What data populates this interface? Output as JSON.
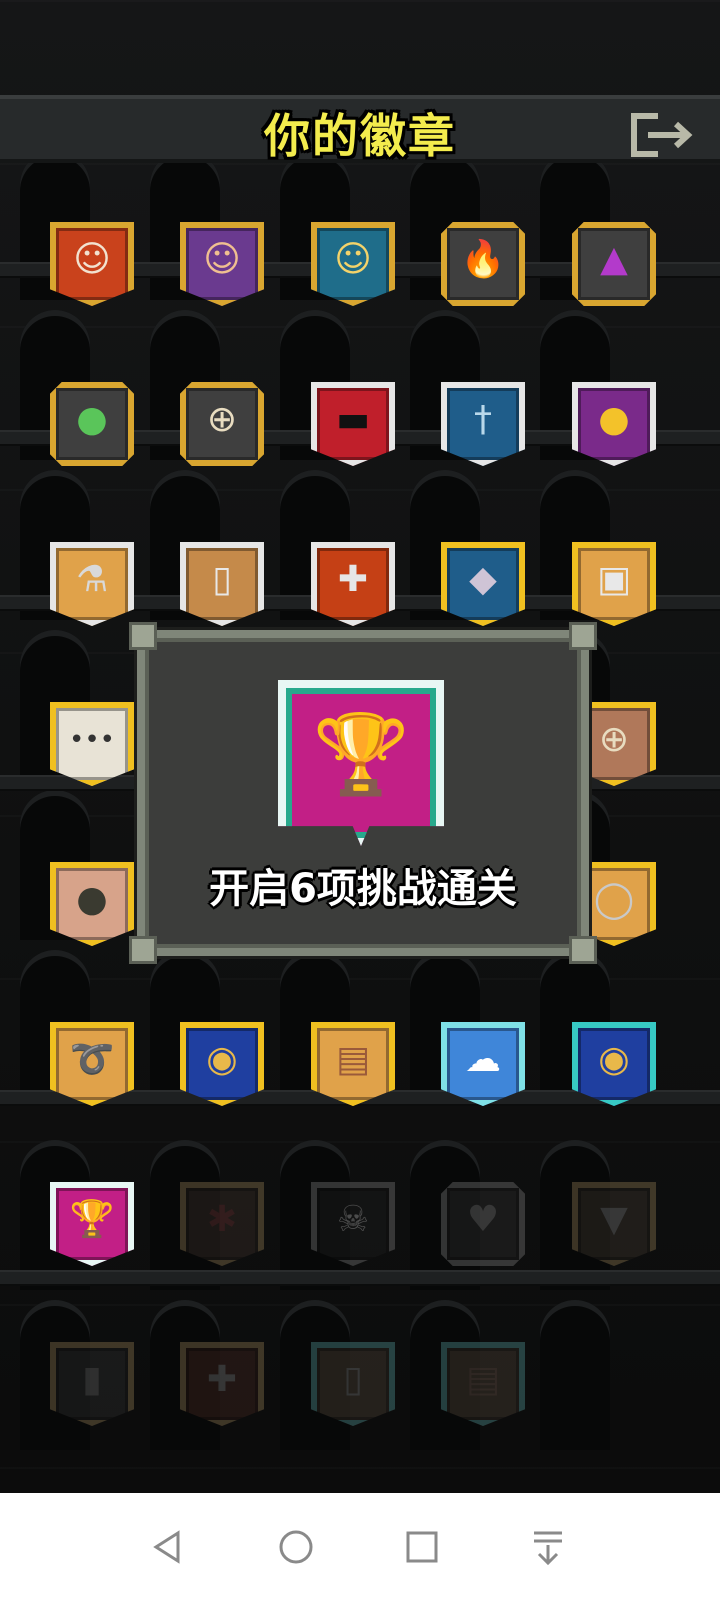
{
  "header": {
    "title": "你的徽章",
    "exit_icon": "exit-door-icon"
  },
  "badges": [
    {
      "name": "badge-warrior-face",
      "icon": "warrior-face-icon",
      "glyph": "☺",
      "frame": "#d9a630",
      "fill": "#c9421c",
      "glyph_color": "#f2e2d0",
      "shape": "shield",
      "dim": false
    },
    {
      "name": "badge-mage-face",
      "icon": "mage-face-icon",
      "glyph": "☺",
      "frame": "#d9a630",
      "fill": "#6a3a8f",
      "glyph_color": "#f0c090",
      "shape": "shield",
      "dim": false
    },
    {
      "name": "badge-rogue-face",
      "icon": "rogue-face-icon",
      "glyph": "☺",
      "frame": "#d9a630",
      "fill": "#1f6d8a",
      "glyph_color": "#f4d36a",
      "shape": "shield",
      "dim": false
    },
    {
      "name": "badge-fire",
      "icon": "flame-icon",
      "glyph": "🔥",
      "frame": "#d9a630",
      "fill": "#3f3f3f",
      "glyph_color": "#ff6a1a",
      "shape": "oct",
      "dim": false
    },
    {
      "name": "badge-potion",
      "icon": "potion-icon",
      "glyph": "▲",
      "frame": "#d9a630",
      "fill": "#3f3f3f",
      "glyph_color": "#b33acb",
      "shape": "oct",
      "dim": false
    },
    {
      "name": "badge-slime",
      "icon": "slime-icon",
      "glyph": "●",
      "frame": "#d9a630",
      "fill": "#3f3f3f",
      "glyph_color": "#5ac55a",
      "shape": "oct",
      "dim": false
    },
    {
      "name": "badge-shield-round",
      "icon": "round-shield-icon",
      "glyph": "⊕",
      "frame": "#d9a630",
      "fill": "#3f3f3f",
      "glyph_color": "#e8dcc0",
      "shape": "oct",
      "dim": false
    },
    {
      "name": "badge-mask",
      "icon": "mask-icon",
      "glyph": "▬",
      "frame": "#e6e6e6",
      "fill": "#c01f2b",
      "glyph_color": "#111111",
      "shape": "shield",
      "dim": false
    },
    {
      "name": "badge-sword",
      "icon": "sword-icon",
      "glyph": "†",
      "frame": "#e6e6e6",
      "fill": "#1f5d8a",
      "glyph_color": "#b9d8ea",
      "shape": "shield",
      "dim": false
    },
    {
      "name": "badge-gold",
      "icon": "gold-coin-icon",
      "glyph": "●",
      "frame": "#e6e6e6",
      "fill": "#7a2a8a",
      "glyph_color": "#f3c22a",
      "shape": "shield",
      "dim": false
    },
    {
      "name": "badge-flask",
      "icon": "flask-icon",
      "glyph": "⚗",
      "frame": "#e6e6e6",
      "fill": "#e0a24a",
      "glyph_color": "#d9d9d9",
      "shape": "shield",
      "dim": false
    },
    {
      "name": "badge-scroll",
      "icon": "scroll-icon",
      "glyph": "▯",
      "frame": "#e6e6e6",
      "fill": "#c58a4a",
      "glyph_color": "#e8e8e8",
      "shape": "shield",
      "dim": false
    },
    {
      "name": "badge-health",
      "icon": "health-cross-icon",
      "glyph": "✚",
      "frame": "#e6e6e6",
      "fill": "#c54015",
      "glyph_color": "#e6e6e6",
      "shape": "shield",
      "dim": false
    },
    {
      "name": "badge-fish",
      "icon": "fish-icon",
      "glyph": "◆",
      "frame": "#f0c020",
      "fill": "#1f5d8a",
      "glyph_color": "#cfc4d6",
      "shape": "shield",
      "dim": false
    },
    {
      "name": "badge-bag",
      "icon": "bag-icon",
      "glyph": "▣",
      "frame": "#f0c020",
      "fill": "#e0a24a",
      "glyph_color": "#e8e8e8",
      "shape": "shield",
      "dim": false
    },
    {
      "name": "badge-dots",
      "icon": "speech-dots-icon",
      "glyph": "•••",
      "frame": "#f0c020",
      "fill": "#e8e3d6",
      "glyph_color": "#333333",
      "shape": "shield",
      "dim": false
    },
    {
      "name": "badge-round-shield-2",
      "icon": "round-shield-icon",
      "glyph": "⊕",
      "frame": "#f0c020",
      "fill": "#b0785a",
      "glyph_color": "#e8dcc0",
      "shape": "shield",
      "dim": false
    },
    {
      "name": "badge-pot",
      "icon": "pot-icon",
      "glyph": "●",
      "frame": "#f0c020",
      "fill": "#d7a38a",
      "glyph_color": "#3a3a30",
      "shape": "shield",
      "dim": false
    },
    {
      "name": "badge-ring",
      "icon": "ring-icon",
      "glyph": "◯",
      "frame": "#f0c020",
      "fill": "#e0a24a",
      "glyph_color": "#c9c9c9",
      "shape": "shield",
      "dim": false
    },
    {
      "name": "badge-rope",
      "icon": "rope-icon",
      "glyph": "➰",
      "frame": "#f0c020",
      "fill": "#e0a24a",
      "glyph_color": "#dedede",
      "shape": "shield",
      "dim": false
    },
    {
      "name": "badge-gem-blue",
      "icon": "rainbow-gem-icon",
      "glyph": "◉",
      "frame": "#f0c020",
      "fill": "#1f3fa0",
      "glyph_color": "#e8b84a",
      "shape": "shield",
      "dim": false
    },
    {
      "name": "badge-chest",
      "icon": "chest-icon",
      "glyph": "▤",
      "frame": "#f0c020",
      "fill": "#e0a24a",
      "glyph_color": "#9a5a3a",
      "shape": "shield",
      "dim": false
    },
    {
      "name": "badge-cloud",
      "icon": "cloud-icon",
      "glyph": "☁",
      "frame": "#7fe0e6",
      "fill": "#3f86d9",
      "glyph_color": "#ffffff",
      "shape": "shield",
      "dim": false
    },
    {
      "name": "badge-gem-teal",
      "icon": "rainbow-gem-icon",
      "glyph": "◉",
      "frame": "#37c9c4",
      "fill": "#1f3fa0",
      "glyph_color": "#e8b84a",
      "shape": "shield",
      "dim": false
    },
    {
      "name": "badge-trophy",
      "icon": "trophy-icon",
      "glyph": "🏆",
      "frame": "#e8f7f4",
      "fill": "#c21f86",
      "glyph_color": "#f6c327",
      "shape": "shield",
      "dim": false
    },
    {
      "name": "badge-locked-figure",
      "icon": "figure-icon",
      "glyph": "✱",
      "frame": "#8a6a30",
      "fill": "#3a2a22",
      "glyph_color": "#7a2a2a",
      "shape": "shield",
      "dim": true
    },
    {
      "name": "badge-locked-skull",
      "icon": "skull-icon",
      "glyph": "☠",
      "frame": "#6a6a6a",
      "fill": "#1c1c1c",
      "glyph_color": "#9a9a9a",
      "shape": "shield",
      "dim": true
    },
    {
      "name": "badge-locked-heart",
      "icon": "heart-icon",
      "glyph": "♥",
      "frame": "#6a6a6a",
      "fill": "#2a2a2a",
      "glyph_color": "#6a6a6a",
      "shape": "oct",
      "dim": true
    },
    {
      "name": "badge-locked-armor",
      "icon": "armor-icon",
      "glyph": "▼",
      "frame": "#8a6a30",
      "fill": "#3a3024",
      "glyph_color": "#6a6a6a",
      "shape": "shield",
      "dim": true
    },
    {
      "name": "badge-locked-tomb",
      "icon": "tombstone-icon",
      "glyph": "▮",
      "frame": "#8a6a30",
      "fill": "#2a2a2a",
      "glyph_color": "#5a5a5a",
      "shape": "shield",
      "dim": true
    },
    {
      "name": "badge-locked-cross",
      "icon": "health-cross-icon",
      "glyph": "✚",
      "frame": "#8a6a30",
      "fill": "#4a2016",
      "glyph_color": "#6a6a6a",
      "shape": "shield",
      "dim": true
    },
    {
      "name": "badge-locked-door",
      "icon": "door-icon",
      "glyph": "▯",
      "frame": "#2a8a8a",
      "fill": "#4a3a2a",
      "glyph_color": "#6a6a6a",
      "shape": "shield",
      "dim": true
    },
    {
      "name": "badge-locked-chest",
      "icon": "chest-icon",
      "glyph": "▤",
      "frame": "#2a8a8a",
      "fill": "#4a3a2a",
      "glyph_color": "#6a4a3a",
      "shape": "shield",
      "dim": true
    }
  ],
  "dialog": {
    "text": "开启6项挑战通关",
    "badge_icon": "trophy-icon",
    "trophy_glyph": "🏆"
  },
  "navbar": {
    "back_icon": "back-triangle-icon",
    "home_icon": "home-circle-icon",
    "recents_icon": "recents-square-icon",
    "menu_icon": "pull-down-icon"
  },
  "colors": {
    "title_yellow": "#f3ec4d",
    "dialog_bg": "#3c3d3b",
    "dialog_border": "#7f8679"
  }
}
